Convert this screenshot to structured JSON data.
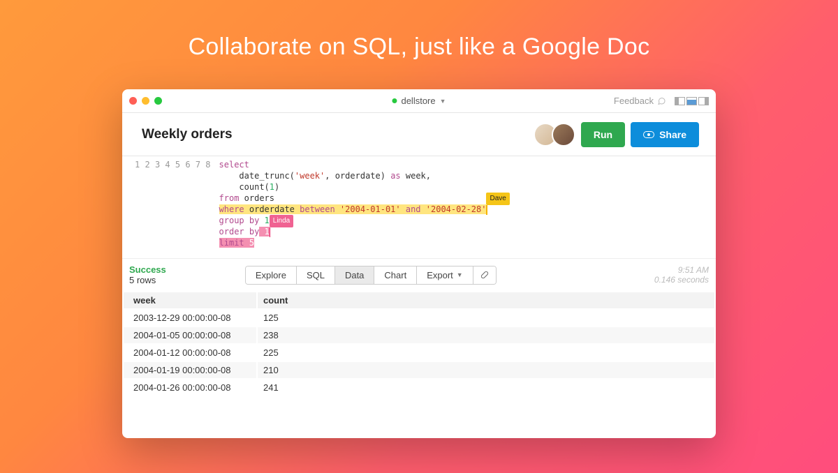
{
  "headline": "Collaborate on SQL, just like a Google Doc",
  "titlebar": {
    "database": "dellstore",
    "feedback_label": "Feedback"
  },
  "toolbar": {
    "query_title": "Weekly orders",
    "run_label": "Run",
    "share_label": "Share"
  },
  "editor": {
    "lines": [
      "1",
      "2",
      "3",
      "4",
      "5",
      "6",
      "7",
      "8"
    ],
    "code": {
      "l1": "select",
      "l2_indent": "    ",
      "l2_fn": "date_trunc(",
      "l2_str": "'week'",
      "l2_mid": ", orderdate)",
      "l2_as": " as ",
      "l2_end": "week,",
      "l3_indent": "    ",
      "l3_fn": "count(",
      "l3_num": "1",
      "l3_end": ")",
      "l4_from": "from",
      "l4_tbl": " orders",
      "l5_where": "where",
      "l5_mid": " orderdate ",
      "l5_between": "between",
      "l5_str1": " '2004-01-01' ",
      "l5_and": "and",
      "l5_str2": " '2004-02-28'",
      "l6_group": "group by",
      "l6_num": " 1",
      "l7_order": "order by",
      "l7_num": " 1",
      "l8_limit": "limit",
      "l8_num": " 5"
    },
    "cursors": {
      "dave": "Dave",
      "linda": "Linda"
    }
  },
  "results": {
    "status": "Success",
    "rowcount_label": "5 rows",
    "tabs": {
      "explore": "Explore",
      "sql": "SQL",
      "data": "Data",
      "chart": "Chart",
      "export": "Export"
    },
    "timestamp": "9:51 AM",
    "duration": "0.146 seconds",
    "columns": {
      "week": "week",
      "count": "count"
    },
    "rows": [
      {
        "week": "2003-12-29 00:00:00-08",
        "count": "125"
      },
      {
        "week": "2004-01-05 00:00:00-08",
        "count": "238"
      },
      {
        "week": "2004-01-12 00:00:00-08",
        "count": "225"
      },
      {
        "week": "2004-01-19 00:00:00-08",
        "count": "210"
      },
      {
        "week": "2004-01-26 00:00:00-08",
        "count": "241"
      }
    ]
  }
}
